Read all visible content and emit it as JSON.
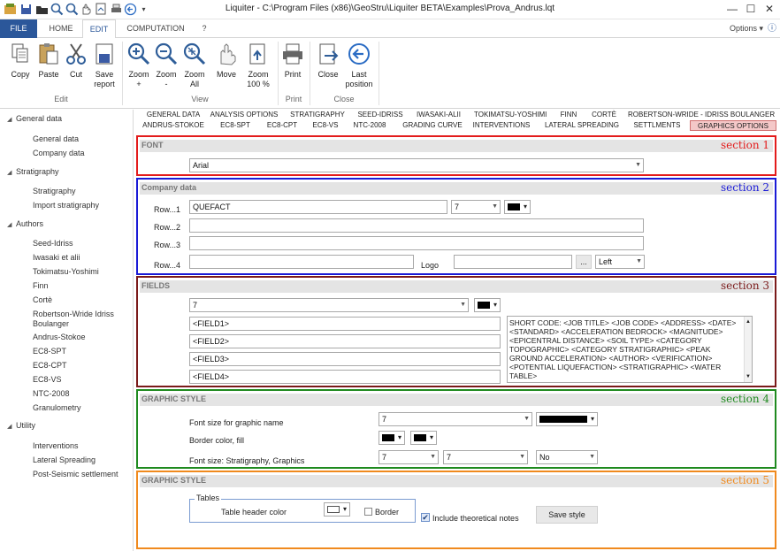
{
  "window": {
    "title": "Liquiter - C:\\Program Files (x86)\\GeoStru\\Liquiter BETA\\Examples\\Prova_Andrus.lqt",
    "minimize": "—",
    "maximize": "☐",
    "close": "✕"
  },
  "ribbon_tabs": {
    "file": "FILE",
    "home": "HOME",
    "edit": "EDIT",
    "computation": "COMPUTATION",
    "help": "?",
    "options": "Options ▾"
  },
  "ribbon": {
    "copy": "Copy",
    "paste": "Paste",
    "cut": "Cut",
    "save_report_1": "Save",
    "save_report_2": "report",
    "zoom_plus_1": "Zoom",
    "zoom_plus_2": "+",
    "zoom_minus_1": "Zoom",
    "zoom_minus_2": "-",
    "zoom_all_1": "Zoom",
    "zoom_all_2": "All",
    "move": "Move",
    "zoom100_1": "Zoom",
    "zoom100_2": "100 %",
    "print": "Print",
    "close": "Close",
    "last_position_1": "Last",
    "last_position_2": "position",
    "group_edit": "Edit",
    "group_view": "View",
    "group_print": "Print",
    "group_close": "Close"
  },
  "tree": {
    "general_data": "General data",
    "general_items": [
      "General data",
      "Company data"
    ],
    "stratigraphy": "Stratigraphy",
    "strat_items": [
      "Stratigraphy",
      "Import stratigraphy"
    ],
    "authors": "Authors",
    "author_items": [
      "Seed-Idriss",
      "Iwasaki et alii",
      "Tokimatsu-Yoshimi",
      "Finn",
      "Cortè",
      "Robertson-Wride Idriss",
      "Boulanger",
      "Andrus-Stokoe",
      "EC8-SPT",
      "EC8-CPT",
      "EC8-VS",
      "NTC-2008",
      "Granulometry"
    ],
    "utility": "Utility",
    "utility_items": [
      "Interventions",
      "Lateral Spreading",
      "Post-Seismic settlement"
    ]
  },
  "content_tabs_row1": [
    "GENERAL DATA",
    "ANALYSIS OPTIONS",
    "STRATIGRAPHY",
    "SEED-IDRISS",
    "IWASAKI-ALII",
    "TOKIMATSU-YOSHIMI",
    "FINN",
    "CORTÈ",
    "ROBERTSON-WRIDE - IDRISS BOULANGER"
  ],
  "content_tabs_row2": [
    "ANDRUS-STOKOE",
    "EC8-SPT",
    "EC8-CPT",
    "EC8-VS",
    "NTC-2008",
    "GRADING CURVE",
    "INTERVENTIONS",
    "LATERAL SPREADING",
    "SETTLMENTS",
    "GRAPHICS OPTIONS"
  ],
  "section1": {
    "label": "section 1",
    "head": "FONT",
    "font": "Arial"
  },
  "section2": {
    "label": "section 2",
    "head": "Company data",
    "row1_label": "Row...1",
    "row1_value": "QUEFACT",
    "row1_size": "7",
    "row2_label": "Row...2",
    "row3_label": "Row...3",
    "row4_label": "Row...4",
    "logo_label": "Logo",
    "browse": "...",
    "align": "Left"
  },
  "section3": {
    "label": "section 3",
    "head": "FIELDS",
    "size": "7",
    "fields": [
      "<FIELD1>",
      "<FIELD2>",
      "<FIELD3>",
      "<FIELD4>"
    ],
    "codes": "SHORT CODE:  <JOB TITLE>  <JOB CODE>  <ADDRESS>  <DATE>  <STANDARD>  <ACCELERATION BEDROCK>  <MAGNITUDE>  <EPICENTRAL DISTANCE>  <SOIL TYPE>  <CATEGORY TOPOGRAPHIC>  <CATEGORY STRATIGRAPHIC>  <PEAK GROUND ACCELERATION>  <AUTHOR>  <VERIFICATION>  <POTENTIAL LIQUEFACTION>  <STRATIGRAPHIC>  <WATER TABLE>"
  },
  "section4": {
    "label": "section 4",
    "head": "GRAPHIC STYLE",
    "font_size_label": "Font size for graphic name",
    "font_size": "7",
    "border_label": "Border color, fill",
    "strat_label": "Font size: Stratigraphy, Graphics",
    "strat_size": "7",
    "graph_size": "7",
    "no_value": "No"
  },
  "section5": {
    "label": "section 5",
    "head": "GRAPHIC STYLE",
    "tables_legend": "Tables",
    "header_color_label": "Table header color",
    "border_label": "Border",
    "theoretical_label": "Include theoretical notes",
    "save_style": "Save style"
  },
  "colors": {
    "section1": "#e31b1b",
    "section2": "#1a1ad6",
    "section3": "#7a1a1a",
    "section4": "#1f8a1f",
    "section5": "#f08a1e",
    "file_tab": "#2b579a"
  }
}
